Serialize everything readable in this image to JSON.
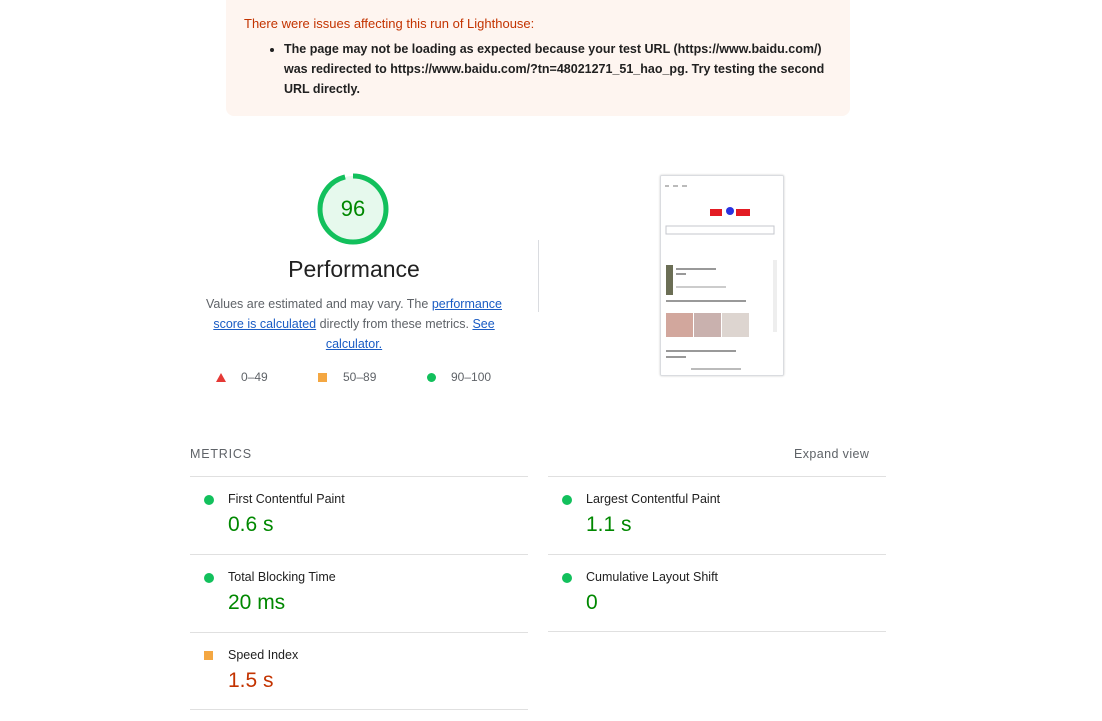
{
  "warning": {
    "title": "There were issues affecting this run of Lighthouse:",
    "items": [
      "The page may not be loading as expected because your test URL (https://www.baidu.com/) was redirected to https://www.baidu.com/?tn=48021271_51_hao_pg. Try testing the second URL directly."
    ]
  },
  "performance": {
    "score": "96",
    "title": "Performance",
    "desc_pre": "Values are estimated and may vary. The ",
    "desc_link1": "performance score is calculated",
    "desc_mid": " directly from these metrics. ",
    "desc_link2": "See calculator."
  },
  "legend": [
    {
      "range": "0–49",
      "shape": "triangle",
      "color": "#e53935"
    },
    {
      "range": "50–89",
      "shape": "square",
      "color": "#f4a742"
    },
    {
      "range": "90–100",
      "shape": "circle",
      "color": "#12c05c"
    }
  ],
  "metrics": {
    "label": "METRICS",
    "expand": "Expand view",
    "items": [
      {
        "name": "First Contentful Paint",
        "value": "0.6 s",
        "status": "pass"
      },
      {
        "name": "Largest Contentful Paint",
        "value": "1.1 s",
        "status": "pass"
      },
      {
        "name": "Total Blocking Time",
        "value": "20 ms",
        "status": "pass"
      },
      {
        "name": "Cumulative Layout Shift",
        "value": "0",
        "status": "pass"
      },
      {
        "name": "Speed Index",
        "value": "1.5 s",
        "status": "average"
      }
    ]
  },
  "colors": {
    "pass": "#12c05c",
    "average": "#f4a742",
    "fail": "#e53935"
  }
}
